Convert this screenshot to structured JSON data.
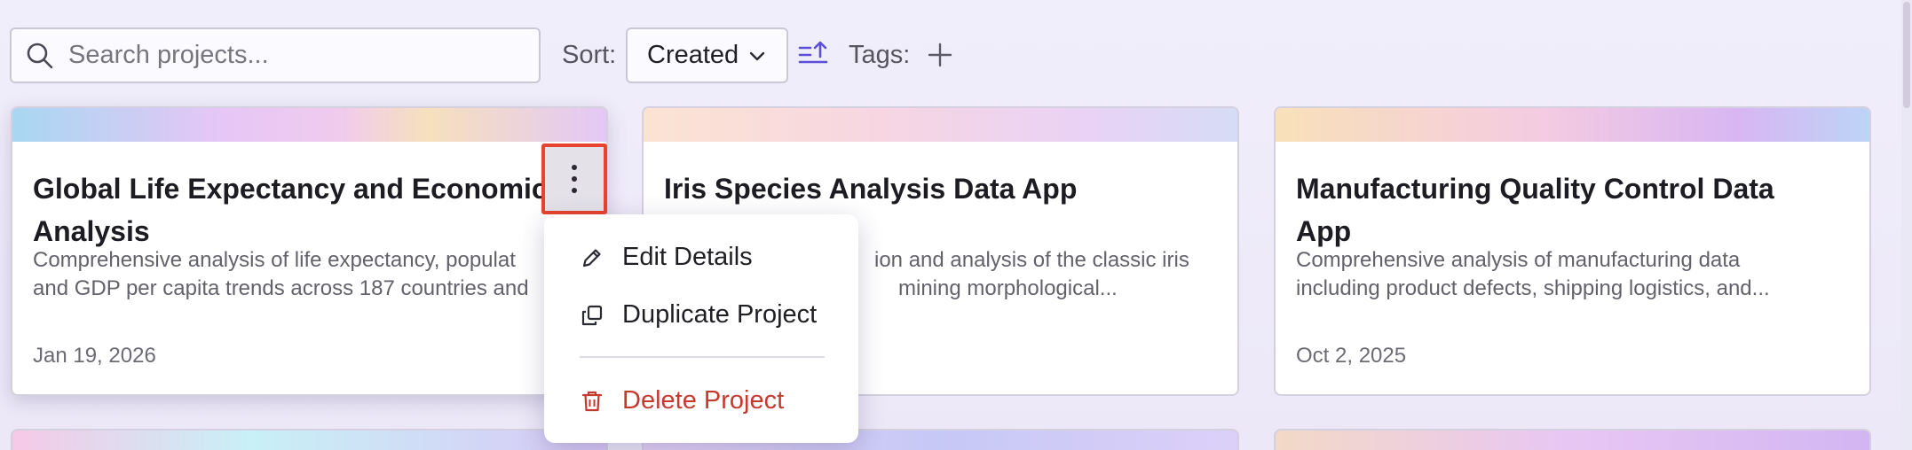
{
  "toolbar": {
    "search_placeholder": "Search projects...",
    "sort_label": "Sort:",
    "sort_value": "Created",
    "tags_label": "Tags:",
    "icons": [
      "search-icon",
      "chevron-down-icon",
      "sort-ascending-icon",
      "plus-icon"
    ]
  },
  "projects": [
    {
      "title": "Global Life Expectancy and Economic Analysis",
      "description_line1": "Comprehensive analysis of life expectancy, populat",
      "description_line2": "and GDP per capita trends across 187 countries and",
      "date": "Jan 19, 2026"
    },
    {
      "title": "Iris Species Analysis Data App",
      "description_line1": "ion and analysis of the classic iris",
      "description_line2": "mining morphological...",
      "date": ""
    },
    {
      "title": "Manufacturing Quality Control Data App",
      "description_line1": "Comprehensive analysis of manufacturing data",
      "description_line2": "including product defects, shipping logistics, and...",
      "date": "Oct 2, 2025"
    }
  ],
  "context_menu": {
    "edit": "Edit Details",
    "duplicate": "Duplicate Project",
    "delete": "Delete Project",
    "delete_color": "#c53a2f"
  },
  "colors": {
    "accent": "#5b4fd6",
    "highlight_border": "#e8432e"
  }
}
